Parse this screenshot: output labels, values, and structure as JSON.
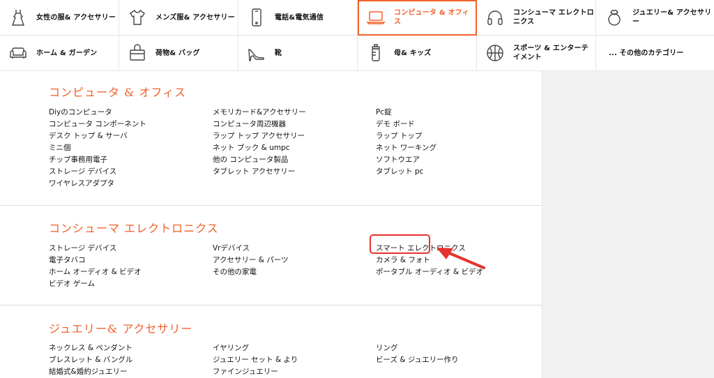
{
  "categories": [
    [
      {
        "id": "womens",
        "label": "女性の服& アクセサリー",
        "icon": "dress-icon",
        "active": false
      },
      {
        "id": "mens",
        "label": "メンズ服& アクセサリー",
        "icon": "tshirt-icon",
        "active": false
      },
      {
        "id": "phones",
        "label": "電話&電気通信",
        "icon": "phone-icon",
        "active": false
      },
      {
        "id": "computer",
        "label": "コンピュータ & オフィス",
        "icon": "laptop-icon",
        "active": true
      },
      {
        "id": "electronics",
        "label": "コンシューマ エレクトロニクス",
        "icon": "headphones-icon",
        "active": false
      },
      {
        "id": "jewelry",
        "label": "ジュエリー& アクセサリー",
        "icon": "ring-icon",
        "active": false
      }
    ],
    [
      {
        "id": "home",
        "label": "ホーム & ガーデン",
        "icon": "sofa-icon",
        "active": false
      },
      {
        "id": "bags",
        "label": "荷物& バッグ",
        "icon": "bag-icon",
        "active": false
      },
      {
        "id": "shoes",
        "label": "靴",
        "icon": "heel-shoe-icon",
        "active": false
      },
      {
        "id": "kids",
        "label": "母& キッズ",
        "icon": "baby-bottle-icon",
        "active": false
      },
      {
        "id": "sports",
        "label": "スポーツ & エンターテイメント",
        "icon": "basketball-icon",
        "active": false
      },
      {
        "id": "other",
        "label": "... その他のカテゴリー",
        "icon": "",
        "active": false
      }
    ]
  ],
  "sections": [
    {
      "title": "コンピュータ & オフィス",
      "columns": [
        [
          "Diyのコンピュータ",
          "コンピュータ コンポーネント",
          "デスク トップ & サーバ",
          "ミニ個",
          "チップ事務用電子",
          "ストレージ デバイス",
          "ワイヤレスアダプタ"
        ],
        [
          "メモリカード&アクセサリー",
          "コンピュータ周辺機器",
          "ラップ トップ アクセサリー",
          "ネット ブック & umpc",
          "他の コンピュータ製品",
          "タブレット アクセサリー"
        ],
        [
          "Pc錠",
          "デモ ボード",
          "ラップ トップ",
          "ネット ワーキング",
          "ソフトウエア",
          "タブレット pc"
        ]
      ]
    },
    {
      "title": "コンシューマ エレクトロニクス",
      "columns": [
        [
          "ストレージ デバイス",
          "電子タバコ",
          "ホーム オーディオ & ビデオ",
          "ビデオ ゲーム"
        ],
        [
          "Vrデバイス",
          "アクセサリー & パーツ",
          "その他の家電"
        ],
        [
          "スマート エレクトロニクス",
          "カメラ & フォト",
          "ポータブル オーディオ & ビデオ"
        ]
      ]
    },
    {
      "title": "ジュエリー& アクセサリー",
      "columns": [
        [
          "ネックレス & ペンダント",
          "ブレスレット & バングル",
          "結婚式&婚約ジュエリー"
        ],
        [
          "イヤリング",
          "ジュエリー セット & より",
          "ファインジュエリー"
        ],
        [
          "リング",
          "ビーズ & ジュエリー作り"
        ]
      ]
    }
  ],
  "colors": {
    "accent": "#f0612a",
    "highlight": "#e5322d"
  }
}
